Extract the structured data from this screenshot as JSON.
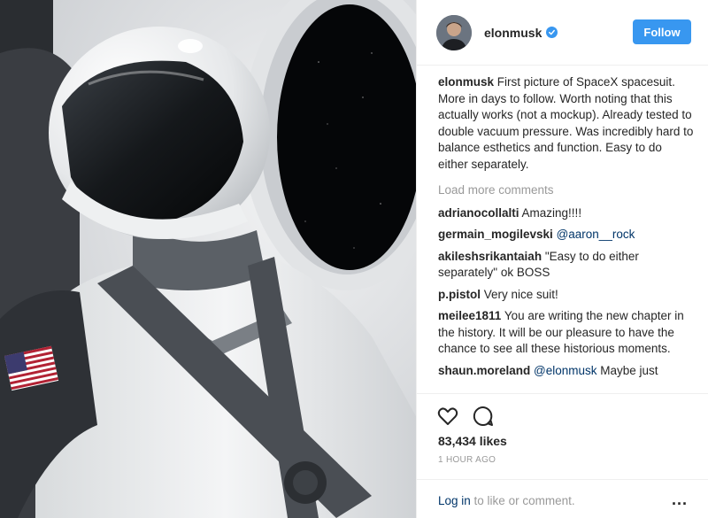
{
  "post": {
    "username": "elonmusk",
    "follow_label": "Follow",
    "caption_user": "elonmusk",
    "caption_text": " First picture of SpaceX spacesuit. More in days to follow. Worth noting that this actually works (not a mockup). Already tested to double vacuum pressure. Was incredibly hard to balance esthetics and function. Easy to do either separately.",
    "load_more": "Load more comments",
    "comments": [
      {
        "user": "adrianocollalti",
        "text": " Amazing!!!!"
      },
      {
        "user": "germain_mogilevski",
        "text": " ",
        "mention": "@aaron__rock"
      },
      {
        "user": "akileshsrikantaiah",
        "text": " \"Easy to do either separately\" ok BOSS"
      },
      {
        "user": "p.pistol",
        "text": " Very nice suit!"
      },
      {
        "user": "meilee1811",
        "text": " You are writing the new chapter in the history. It will be our pleasure to have the chance to see all these historious moments."
      },
      {
        "user": "shaun.moreland",
        "text": " ",
        "mention": "@elonmusk",
        "tail": " Maybe just"
      }
    ],
    "likes": "83,434 likes",
    "time": "1 HOUR AGO",
    "login_link": "Log in",
    "login_rest": " to like or comment.",
    "more": "..."
  },
  "icons": {
    "like": "heart-icon",
    "comment": "comment-bubble-icon",
    "verified": "verified-badge-icon",
    "more": "more-dots-icon"
  },
  "colors": {
    "accent": "#3897f0",
    "link": "#003569",
    "muted": "#999999",
    "text": "#262626"
  }
}
